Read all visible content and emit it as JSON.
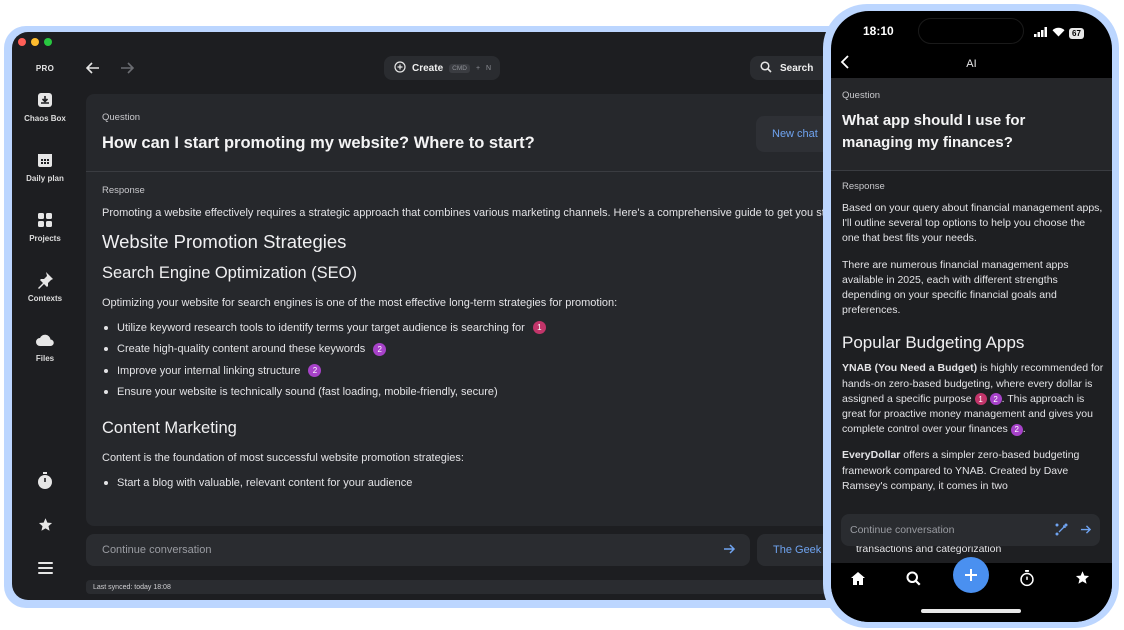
{
  "desktop": {
    "brand": "PRO",
    "traffic_colors": [
      "#ff5f57",
      "#febc2e",
      "#28c840"
    ],
    "sidebar": [
      {
        "label": "Chaos Box",
        "icon": "inbox-icon"
      },
      {
        "label": "Daily plan",
        "icon": "calendar-icon"
      },
      {
        "label": "Projects",
        "icon": "grid-icon"
      },
      {
        "label": "Contexts",
        "icon": "pin-icon"
      },
      {
        "label": "Files",
        "icon": "cloud-icon"
      }
    ],
    "sidebar_bottom": [
      "timer-icon",
      "star-icon",
      "menu-icon"
    ],
    "toolbar": {
      "create_label": "Create",
      "create_shortcut_key1": "CMD",
      "create_shortcut_plus": "+",
      "create_shortcut_key2": "N",
      "search_label": "Search"
    },
    "question": {
      "label": "Question",
      "text": "How can I start promoting my website? Where to start?"
    },
    "new_chat_label": "New chat",
    "response": {
      "label": "Response",
      "intro": "Promoting a website effectively requires a strategic approach that combines various marketing channels. Here's a comprehensive guide to get you started:",
      "heading1": "Website Promotion Strategies",
      "heading2": "Search Engine Optimization (SEO)",
      "seo_intro": "Optimizing your website for search engines is one of the most effective long-term strategies for promotion:",
      "seo_items": [
        {
          "text": "Utilize keyword research tools to identify terms your target audience is searching for",
          "badge": "1"
        },
        {
          "text": "Create high-quality content around these keywords",
          "badge": "2"
        },
        {
          "text": "Improve your internal linking structure",
          "badge": "2"
        },
        {
          "text": "Ensure your website is technically sound (fast loading, mobile-friendly, secure)",
          "badge": ""
        }
      ],
      "heading3": "Content Marketing",
      "content_intro": "Content is the foundation of most successful website promotion strategies:",
      "content_item1": "Start a blog with valuable, relevant content for your audience"
    },
    "continue_placeholder": "Continue conversation",
    "model_label": "The Geek",
    "synced_text": "Last synced: today 18:08",
    "badge_colors": {
      "1": "#c2356a",
      "2": "#a742c9"
    }
  },
  "phone": {
    "time": "18:10",
    "battery": "67",
    "title": "AI",
    "question": {
      "label": "Question",
      "text": "What app should I use for managing my finances?"
    },
    "response": {
      "label": "Response",
      "p1": "Based on your query about financial management apps, I'll outline several top options to help you choose the one that best fits your needs.",
      "p2": "There are numerous financial management apps available in 2025, each with different strengths depending on your specific financial goals and preferences.",
      "heading": "Popular Budgeting Apps",
      "ynab_bold": "YNAB (You Need a Budget)",
      "ynab_text1": " is highly recommended for hands-on zero-based budgeting, where every dollar is assigned a specific purpose",
      "ynab_text2": ". This approach is great for proactive money management and gives you complete control over your finances",
      "everydollar_bold": "EveryDollar",
      "everydollar_text": " offers a simpler zero-based budgeting framework compared to YNAB. Created by Dave Ramsey's company, it comes in two",
      "tail": "transactions and categorization"
    },
    "continue_placeholder": "Continue conversation",
    "nav": [
      "home-icon",
      "search-icon",
      "add-icon",
      "timer-icon",
      "star-icon"
    ]
  }
}
